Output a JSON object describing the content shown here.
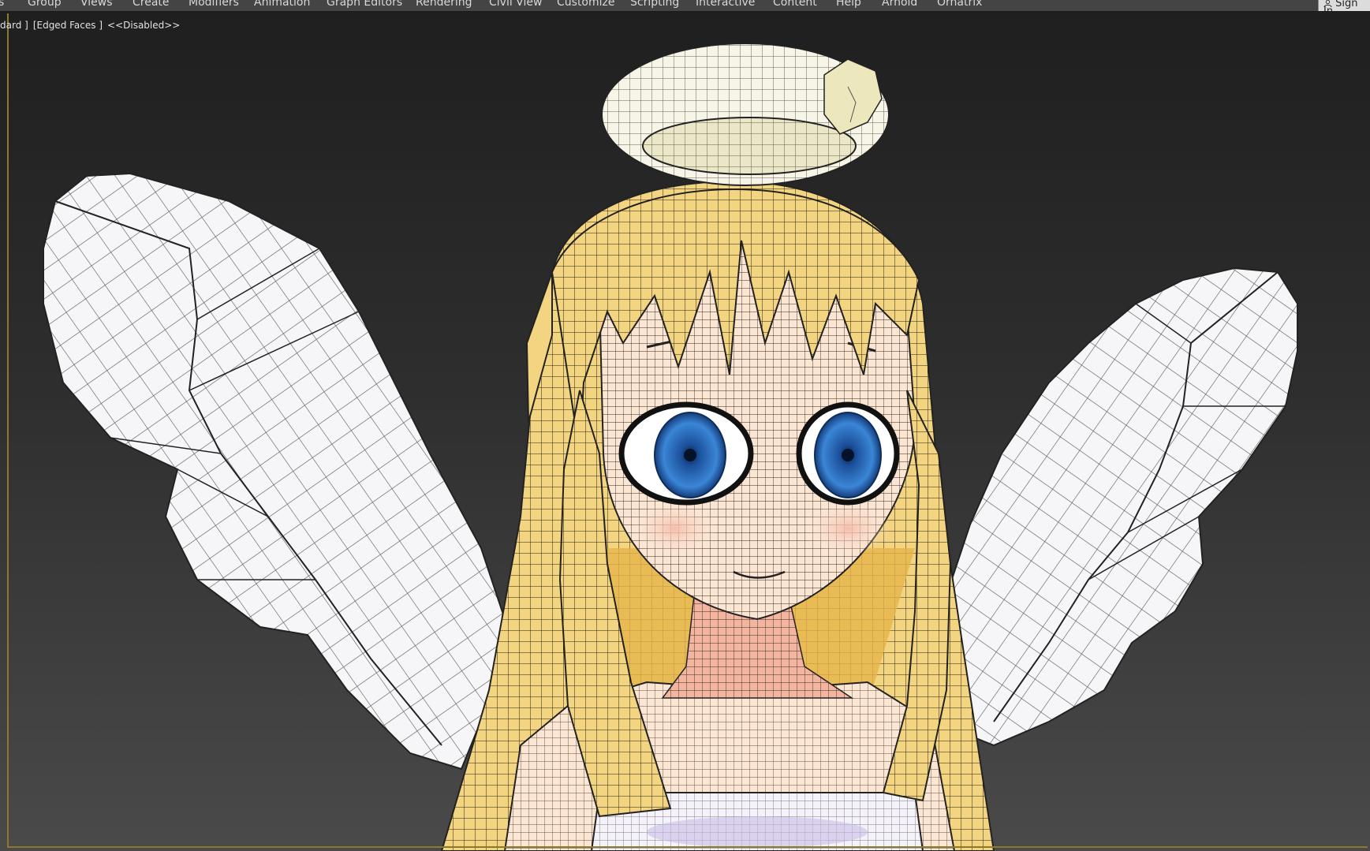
{
  "menubar": {
    "items": [
      {
        "label": "s"
      },
      {
        "label": "Group"
      },
      {
        "label": "Views"
      },
      {
        "label": "Create"
      },
      {
        "label": "Modifiers"
      },
      {
        "label": "Animation"
      },
      {
        "label": "Graph Editors"
      },
      {
        "label": "Rendering"
      },
      {
        "label": "Civil View"
      },
      {
        "label": "Customize"
      },
      {
        "label": "Scripting"
      },
      {
        "label": "Interactive"
      },
      {
        "label": "Content"
      },
      {
        "label": "Help"
      },
      {
        "label": "Arnold"
      },
      {
        "label": "Ornatrix"
      }
    ],
    "sign_in_label": "Sign In"
  },
  "viewport": {
    "labels": {
      "shading": "dard ]",
      "edged_faces": "[Edged Faces ]",
      "disabled": "<<Disabled>>"
    },
    "colors": {
      "hair": "#f3d480",
      "skin": "#fbe6d4",
      "wing": "#f6f6f8",
      "halo": "#f7f5e8",
      "eye": "#2f6fc3",
      "neck": "#f4b5a0",
      "frame": "#8c7a2c"
    }
  }
}
